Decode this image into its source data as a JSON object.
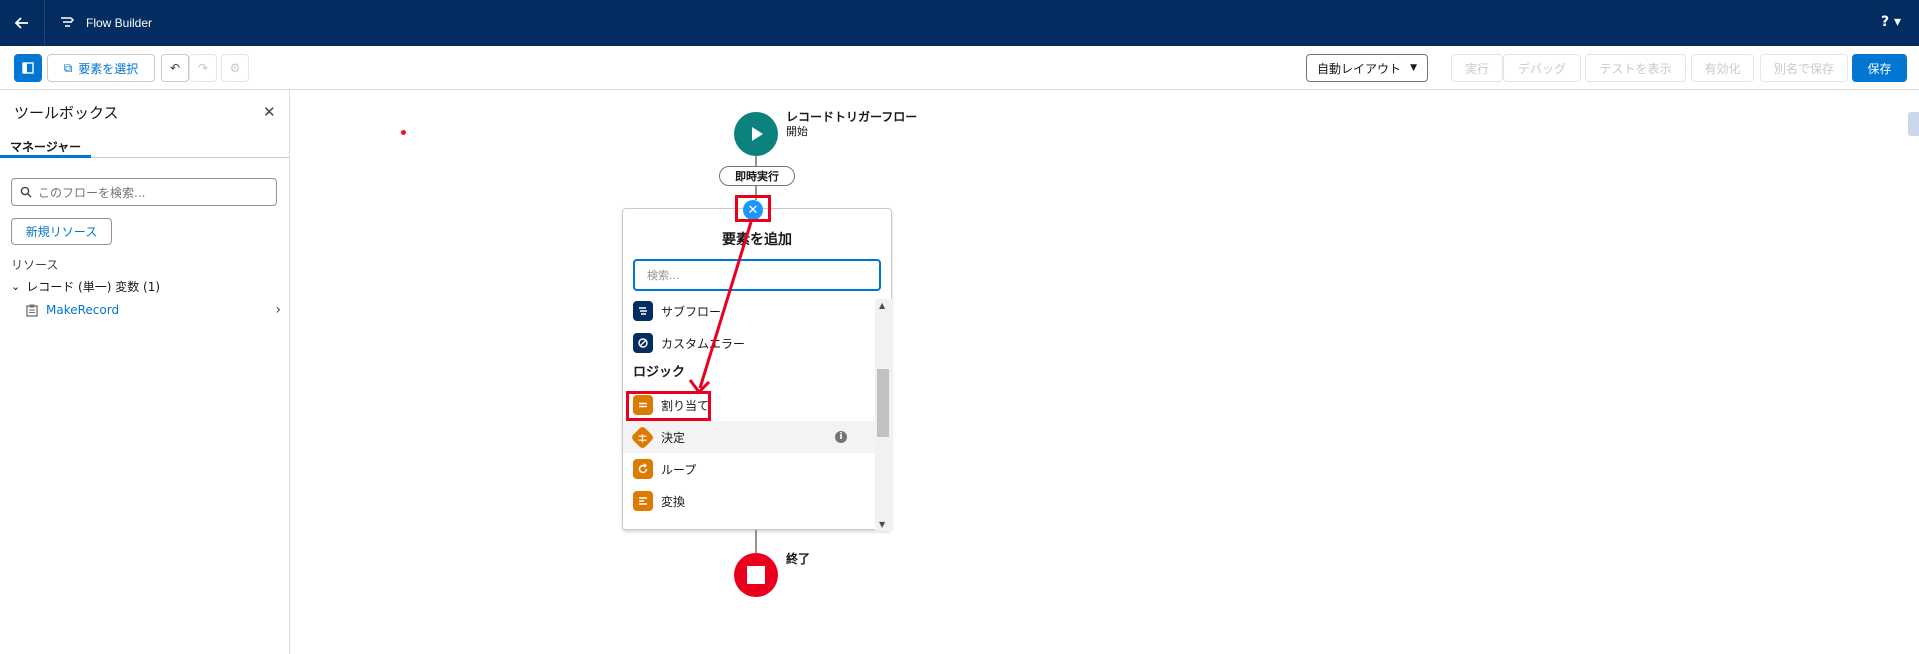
{
  "header": {
    "app_title": "Flow Builder",
    "help_label": "?",
    "background": "#032d60"
  },
  "toolbar": {
    "select_elements": "要素を選択",
    "layout_select": "自動レイアウト",
    "run": "実行",
    "debug": "デバッグ",
    "view_tests": "テストを表示",
    "activate": "有効化",
    "save_as": "別名で保存",
    "save": "保存"
  },
  "sidebar": {
    "title": "ツールボックス",
    "tab_manager": "マネージャー",
    "search_placeholder": "このフローを検索...",
    "new_resource": "新規リソース",
    "resources_label": "リソース",
    "group_label": "レコード (単一) 変数 (1)",
    "item_label": "MakeRecord"
  },
  "canvas": {
    "start_title": "レコードトリガーフロー",
    "start_subtitle": "開始",
    "path_label": "即時実行",
    "end_title": "終了",
    "add_element": {
      "title": "要素を追加",
      "search_placeholder": "検索...",
      "items": [
        {
          "label": "サブフロー",
          "icon": "subflow-icon",
          "color": "#032d60"
        },
        {
          "label": "カスタムエラー",
          "icon": "custom-error-icon",
          "color": "#032d60"
        }
      ],
      "section_logic": "ロジック",
      "logic_items": [
        {
          "label": "割り当て",
          "icon": "assignment-icon",
          "color": "#dd7a01"
        },
        {
          "label": "決定",
          "icon": "decision-icon",
          "color": "#dd7a01"
        },
        {
          "label": "ループ",
          "icon": "loop-icon",
          "color": "#dd7a01"
        },
        {
          "label": "変換",
          "icon": "transform-icon",
          "color": "#dd7a01"
        }
      ]
    }
  },
  "colors": {
    "brand": "#0176d3",
    "start_node": "#0b827c",
    "end_node": "#ea001e",
    "annotation_red": "#ea001e"
  }
}
